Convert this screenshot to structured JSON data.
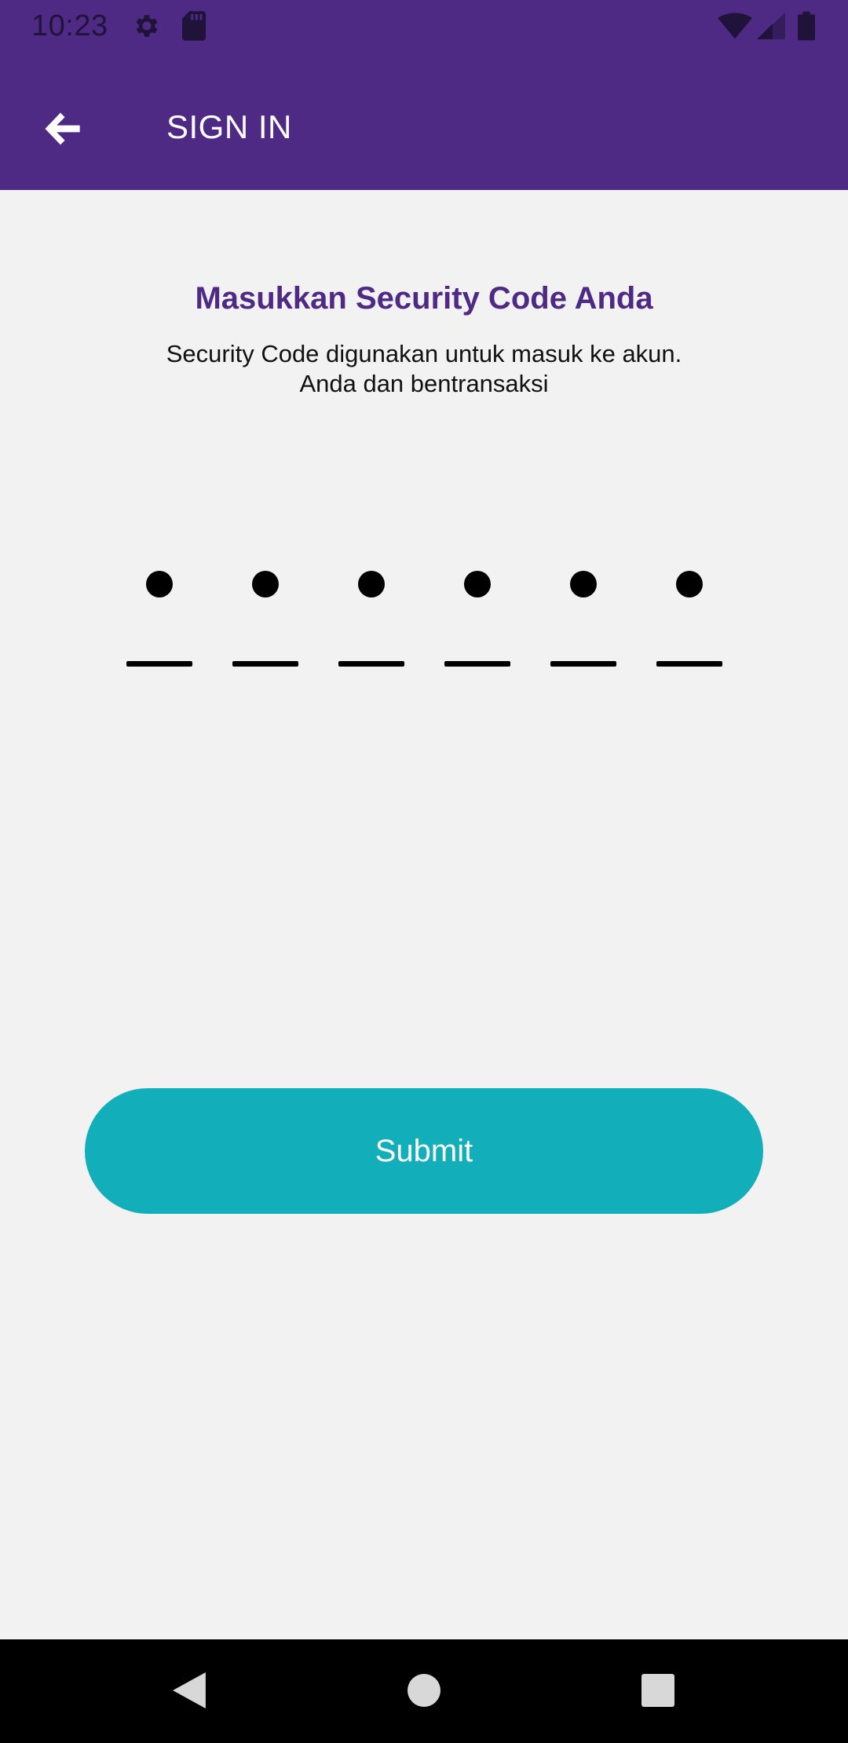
{
  "status_bar": {
    "time": "10:23",
    "icons": [
      "gear-icon",
      "sd-card-icon",
      "wifi-icon",
      "cell-signal-icon",
      "battery-icon"
    ]
  },
  "app_bar": {
    "title": "SIGN IN",
    "back_icon": "arrow-left-icon"
  },
  "main": {
    "heading": "Masukkan Security Code Anda",
    "subtext_line1": "Security Code digunakan untuk masuk ke akun.",
    "subtext_line2": "Anda dan bentransaksi",
    "code_length": 6,
    "code_filled": 6,
    "submit_label": "Submit"
  },
  "nav_bar": {
    "icons": [
      "nav-back-icon",
      "nav-home-icon",
      "nav-recents-icon"
    ]
  },
  "colors": {
    "primary": "#4e2a84",
    "accent": "#12afba",
    "background": "#f2f2f2"
  }
}
